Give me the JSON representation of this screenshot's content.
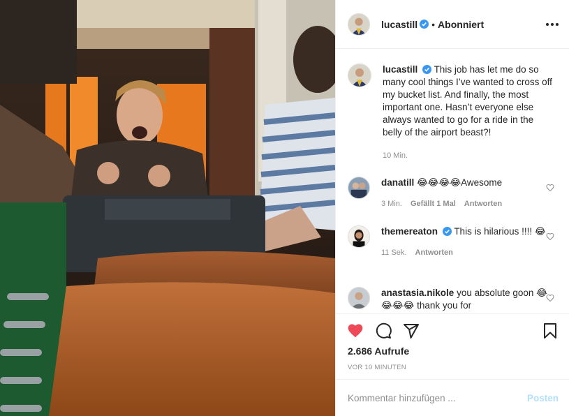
{
  "post_header": {
    "username": "lucastill",
    "separator": "•",
    "follow_state": "Abonniert"
  },
  "caption": {
    "username": "lucastill",
    "text": "This job has let me do so many cool things I’ve wanted to cross off my bucket list. And finally, the most important one. Hasn’t everyone else always wanted to go for a ride in the belly of the airport beast?!",
    "time": "10 Min."
  },
  "comments": [
    {
      "username": "danatill",
      "text": "😂😂😂😂Awesome",
      "time": "3 Min.",
      "likes": "Gefällt 1 Mal",
      "reply": "Antworten"
    },
    {
      "username": "themereaton",
      "text": "This is hilarious !!!! 😂",
      "time": "11 Sek.",
      "reply": "Antworten"
    },
    {
      "username": "anastasia.nikole",
      "text": "you absolute goon 😂😂😂😂 thank you for"
    }
  ],
  "icons": {
    "like": "heart-filled-icon",
    "comment": "comment-bubble-icon",
    "share": "paper-plane-icon",
    "save": "bookmark-icon",
    "more": "ellipsis-icon",
    "verified": "verified-badge-icon"
  },
  "stats": {
    "views": "2.686 Aufrufe",
    "posted_ago": "VOR 10 MINUTEN"
  },
  "add_comment": {
    "placeholder": "Kommentar hinzufügen ...",
    "post_label": "Posten"
  },
  "colors": {
    "like_red": "#ed4956",
    "verified_blue": "#3897f0",
    "muted": "#8e8e8e",
    "post_disabled": "#b2dffc"
  }
}
